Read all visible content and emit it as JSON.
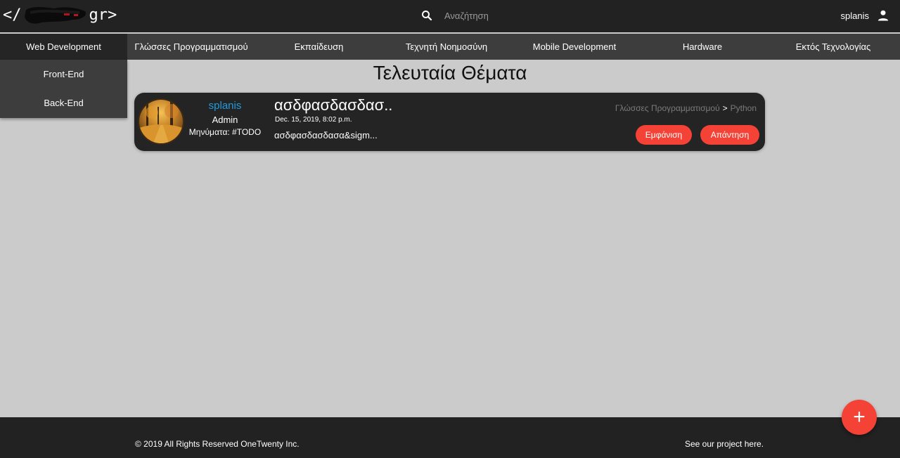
{
  "header": {
    "logo_prefix": "</",
    "logo_suffix": "gr>",
    "search_placeholder": "Αναζήτηση",
    "username": "splanis"
  },
  "nav": {
    "categories": [
      {
        "label": "Web Development",
        "active": true
      },
      {
        "label": "Γλώσσες Προγραμματισμού"
      },
      {
        "label": "Εκπαίδευση"
      },
      {
        "label": "Τεχνητή Νοημοσύνη"
      },
      {
        "label": "Mobile Development"
      },
      {
        "label": "Hardware"
      },
      {
        "label": "Εκτός Τεχνολογίας"
      }
    ],
    "dropdown": [
      "Front-End",
      "Back-End"
    ]
  },
  "main": {
    "heading": "Τελευταία Θέματα",
    "topic": {
      "author": "splanis",
      "role": "Admin",
      "posts": "Μηνύματα: #TODO",
      "title": "ασδφασδασδασ..",
      "date": "Dec. 15, 2019, 8:02 p.m.",
      "excerpt": "ασδφασδασδασα&sigm...",
      "breadcrumb_category": "Γλώσσες Προγραμματισμού",
      "breadcrumb_sep": ">",
      "breadcrumb_sub": "Python",
      "view_label": "Εμφάνιση",
      "reply_label": "Απάντηση"
    }
  },
  "footer": {
    "copyright": "© 2019 All Rights Reserved OneTwenty Inc.",
    "project_link": "See our project here."
  },
  "fab": {
    "label": "+"
  },
  "colors": {
    "accent": "#f44336",
    "link": "#1f9bde",
    "bar": "#222222",
    "nav": "#3d3d3d",
    "background": "#cbcbcb"
  }
}
